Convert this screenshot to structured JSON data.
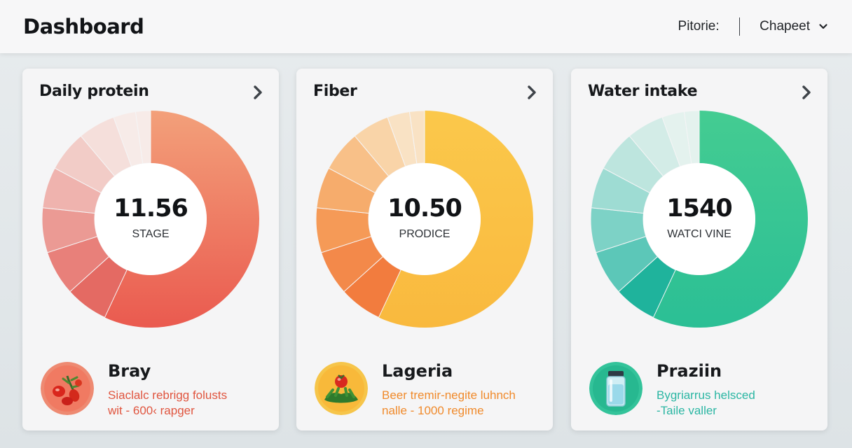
{
  "header": {
    "title": "Dashboard",
    "filter_label": "Pitorie:",
    "select_value": "Chapeet"
  },
  "cards": [
    {
      "title": "Daily protein",
      "center_value": "11.56",
      "center_label": "STAGE",
      "item_name": "Bray",
      "item_desc_line1": "Siaclalc rebrigg folusts",
      "item_desc_line2": "wit - 600‹ rapger",
      "desc_color": "#e0553f",
      "icon": "tomato-icon",
      "colors": [
        "#ea5a4f",
        "#e46a63",
        "#e8807a",
        "#eb9a94",
        "#efb3ae",
        "#f2ccc7",
        "#f5dfdb",
        "#f7ebe8",
        "#f3a07a"
      ]
    },
    {
      "title": "Fiber",
      "center_value": "10.50",
      "center_label": "PRODICE",
      "item_name": "Lageria",
      "item_desc_line1": "Beer tremir-negite luhnch",
      "item_desc_line2": "nalle - 1000 regime",
      "desc_color": "#f08a2b",
      "icon": "vegetable-icon",
      "colors": [
        "#f9b93e",
        "#f27c3e",
        "#f3894a",
        "#f59a57",
        "#f6ac6c",
        "#f8c088",
        "#f9d4a8",
        "#f9e2c4",
        "#fbc84b"
      ]
    },
    {
      "title": "Water intake",
      "center_value": "1540",
      "center_label": "WATCI VINE",
      "item_name": "Praziin",
      "item_desc_line1": "Bygriarrus helsced",
      "item_desc_line2": "-Taile valler",
      "desc_color": "#2bb6a3",
      "icon": "water-bottle-icon",
      "colors": [
        "#2bbf95",
        "#1fb39c",
        "#5cc7b8",
        "#7dd2c6",
        "#9edcd3",
        "#bde5de",
        "#d3ece7",
        "#e4f2ee",
        "#44cc92"
      ]
    }
  ]
}
